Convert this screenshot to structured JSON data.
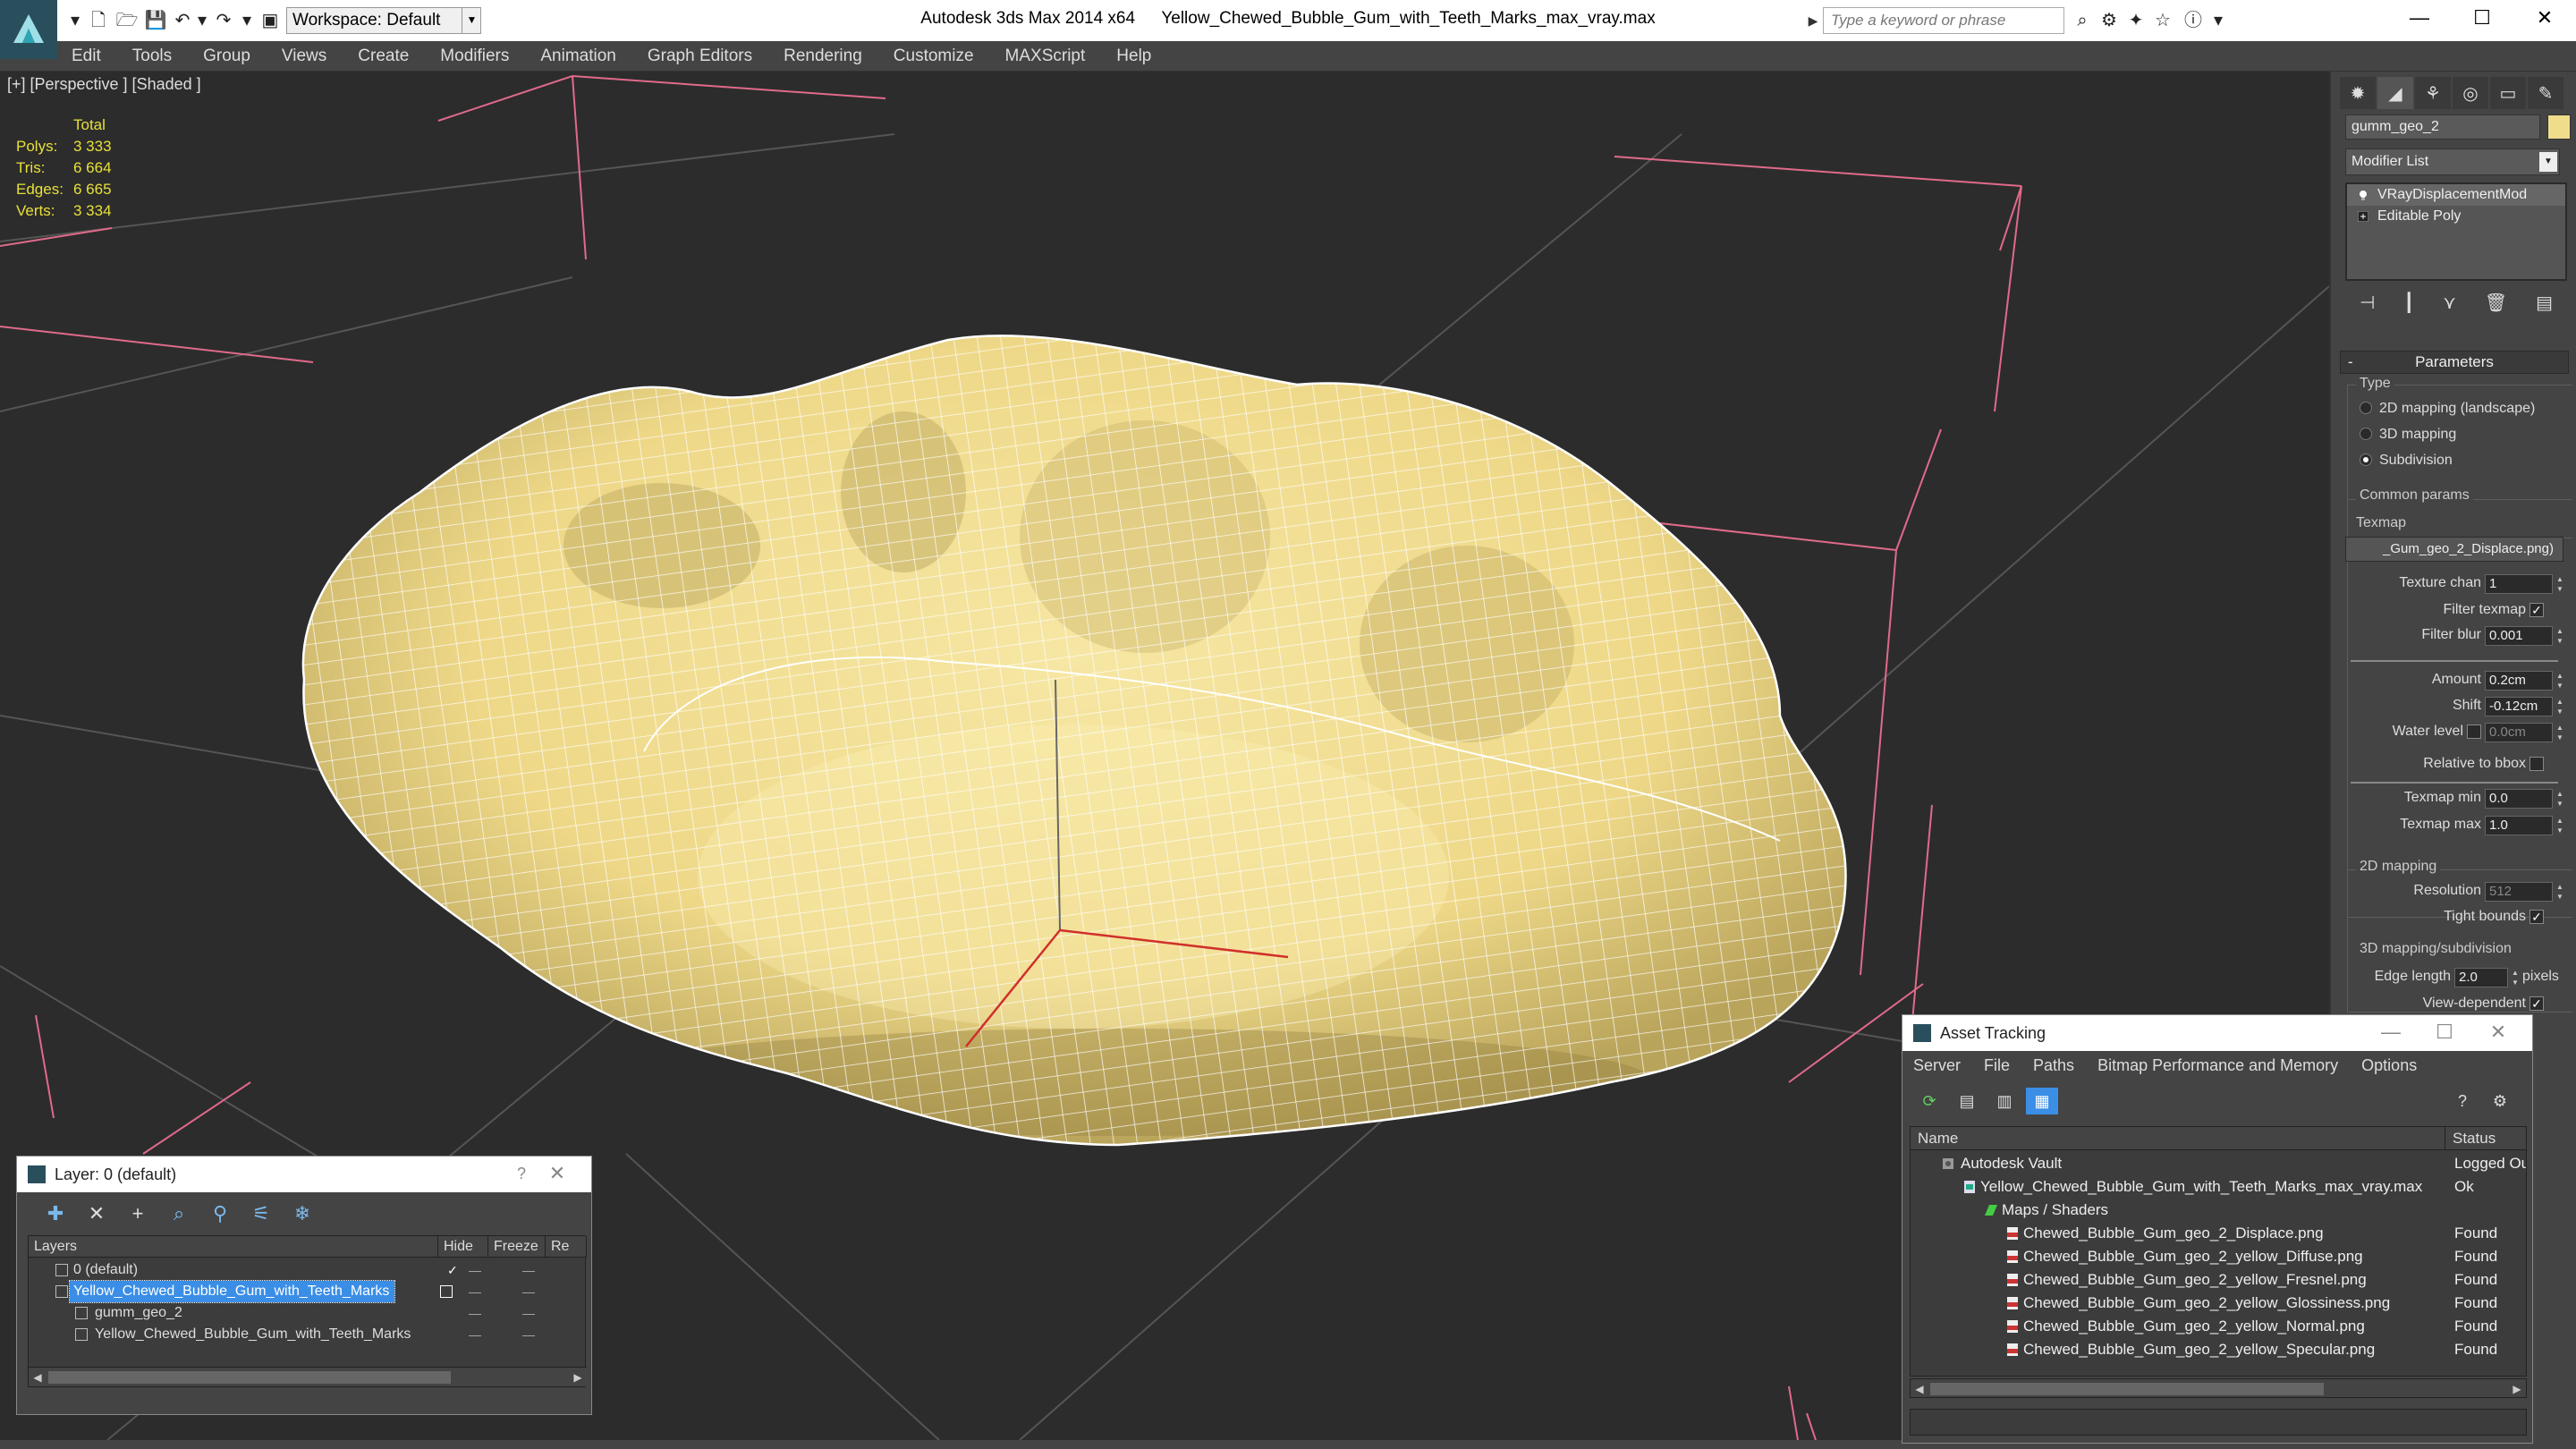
{
  "titlebar": {
    "app": "Autodesk 3ds Max  2014 x64",
    "file": "Yellow_Chewed_Bubble_Gum_with_Teeth_Marks_max_vray.max",
    "workspace": "Workspace: Default",
    "search_placeholder": "Type a keyword or phrase"
  },
  "menu": [
    "Edit",
    "Tools",
    "Group",
    "Views",
    "Create",
    "Modifiers",
    "Animation",
    "Graph Editors",
    "Rendering",
    "Customize",
    "MAXScript",
    "Help"
  ],
  "viewport": {
    "label": "[+] [Perspective ] [Shaded ]",
    "stats": {
      "header": "Total",
      "rows": [
        {
          "label": "Polys:",
          "value": "3 333"
        },
        {
          "label": "Tris:",
          "value": "6 664"
        },
        {
          "label": "Edges:",
          "value": "6 665"
        },
        {
          "label": "Verts:",
          "value": "3 334"
        }
      ]
    },
    "object_color": "#f0dd8c"
  },
  "command_panel": {
    "object_name": "gumm_geo_2",
    "modifier_list": "Modifier List",
    "stack": [
      "VRayDisplacementMod",
      "Editable Poly"
    ],
    "parameters_title": "Parameters",
    "type_label": "Type",
    "type_options": [
      {
        "label": "2D mapping (landscape)",
        "selected": false
      },
      {
        "label": "3D mapping",
        "selected": false
      },
      {
        "label": "Subdivision",
        "selected": true
      }
    ],
    "common_params": "Common params",
    "texmap_label": "Texmap",
    "texmap_value": "_Gum_geo_2_Displace.png)",
    "texture_chan_label": "Texture chan",
    "texture_chan": "1",
    "filter_texmap": "Filter texmap",
    "filter_blur_label": "Filter blur",
    "filter_blur": "0.001",
    "amount_label": "Amount",
    "amount": "0.2cm",
    "shift_label": "Shift",
    "shift": "-0.12cm",
    "water_level_label": "Water level",
    "water_level": "0.0cm",
    "relative_bbox": "Relative to bbox",
    "texmap_min_label": "Texmap min",
    "texmap_min": "0.0",
    "texmap_max_label": "Texmap max",
    "texmap_max": "1.0",
    "mapping_2d": "2D mapping",
    "resolution_label": "Resolution",
    "resolution": "512",
    "tight_bounds": "Tight bounds",
    "mapping_3d": "3D mapping/subdivision",
    "edge_length_label": "Edge length",
    "edge_length": "2.0",
    "pixels": "pixels",
    "view_dependent": "View-dependent"
  },
  "layer_dialog": {
    "title": "Layer: 0 (default)",
    "help": "?",
    "columns": [
      "Layers",
      "Hide",
      "Freeze",
      "Re"
    ],
    "rows": [
      {
        "name": "0 (default)",
        "indent": 0,
        "selected": false
      },
      {
        "name": "Yellow_Chewed_Bubble_Gum_with_Teeth_Marks",
        "indent": 0,
        "selected": true
      },
      {
        "name": "gumm_geo_2",
        "indent": 1,
        "selected": false
      },
      {
        "name": "Yellow_Chewed_Bubble_Gum_with_Teeth_Marks",
        "indent": 1,
        "selected": false
      }
    ]
  },
  "asset_dialog": {
    "title": "Asset Tracking",
    "menu": [
      "Server",
      "File",
      "Paths",
      "Bitmap Performance and Memory",
      "Options"
    ],
    "columns": [
      "Name",
      "Status"
    ],
    "rows": [
      {
        "name": "Autodesk Vault",
        "status": "Logged Ou",
        "indent": 0,
        "icon": "vault"
      },
      {
        "name": "Yellow_Chewed_Bubble_Gum_with_Teeth_Marks_max_vray.max",
        "status": "Ok",
        "indent": 1,
        "icon": "max"
      },
      {
        "name": "Maps / Shaders",
        "status": "",
        "indent": 2,
        "icon": "folder"
      },
      {
        "name": "Chewed_Bubble_Gum_geo_2_Displace.png",
        "status": "Found",
        "indent": 3,
        "icon": "png"
      },
      {
        "name": "Chewed_Bubble_Gum_geo_2_yellow_Diffuse.png",
        "status": "Found",
        "indent": 3,
        "icon": "png"
      },
      {
        "name": "Chewed_Bubble_Gum_geo_2_yellow_Fresnel.png",
        "status": "Found",
        "indent": 3,
        "icon": "png"
      },
      {
        "name": "Chewed_Bubble_Gum_geo_2_yellow_Glossiness.png",
        "status": "Found",
        "indent": 3,
        "icon": "png"
      },
      {
        "name": "Chewed_Bubble_Gum_geo_2_yellow_Normal.png",
        "status": "Found",
        "indent": 3,
        "icon": "png"
      },
      {
        "name": "Chewed_Bubble_Gum_geo_2_yellow_Specular.png",
        "status": "Found",
        "indent": 3,
        "icon": "png"
      }
    ]
  }
}
